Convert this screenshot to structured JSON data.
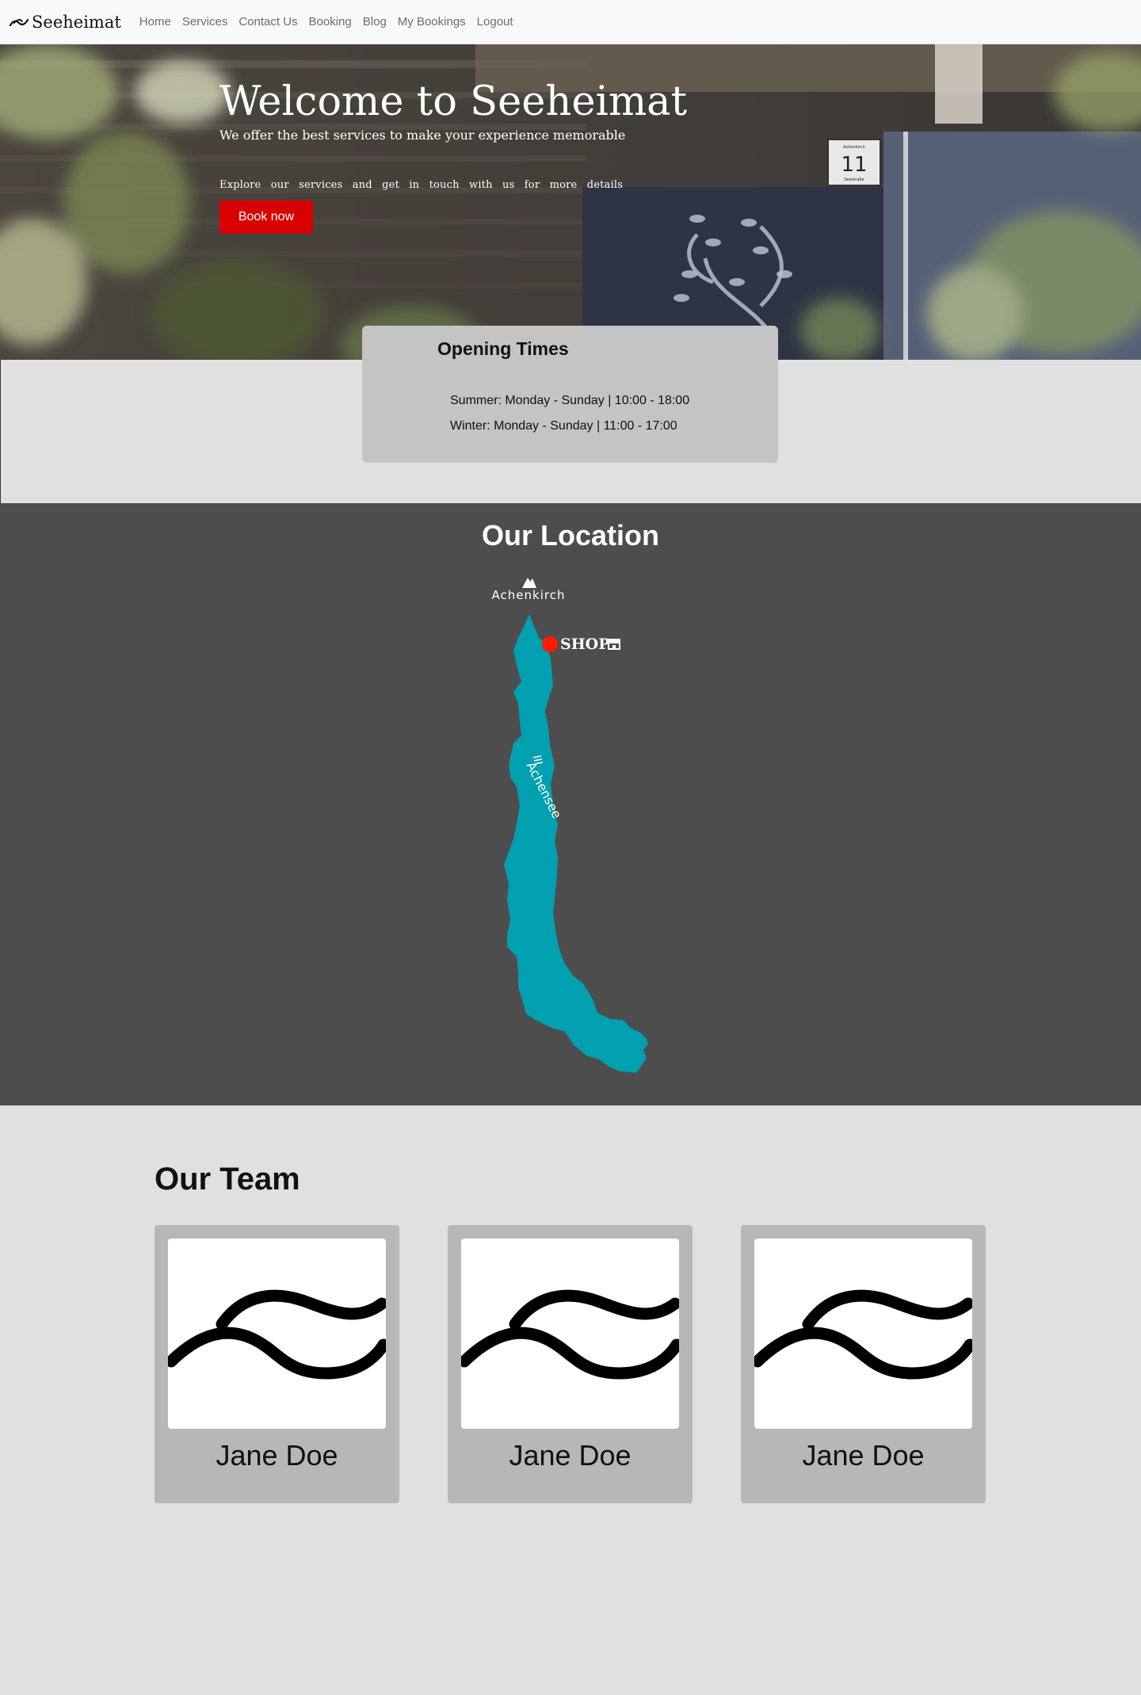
{
  "nav": {
    "brand": "Seeheimat",
    "brand_icon": "wave-logo-icon",
    "links": [
      "Home",
      "Services",
      "Contact Us",
      "Booking",
      "Blog",
      "My Bookings",
      "Logout"
    ]
  },
  "hero": {
    "title": "Welcome to Seeheimat",
    "subtitle": "We offer the best services to make your experience memorable",
    "text": "Explore our services and get in touch with us for more details",
    "button": "Book now",
    "house_number": "11",
    "street_sign": "Seestraße",
    "street_sign_top": "Achenkirch"
  },
  "opening": {
    "title": "Opening Times",
    "summer": "Summer: Monday - Sunday | 10:00 - 18:00",
    "winter": "Winter: Monday - Sunday | 11:00 - 17:00"
  },
  "location": {
    "title": "Our Location",
    "town": "Achenkirch",
    "town_icon": "mountain-icon",
    "lake": "Achensee",
    "lake_icon": "water-waves-icon",
    "shop_label": "SHOP",
    "shop_icon": "store-icon",
    "colors": {
      "lake": "#00a0b0",
      "marker": "#ff1a00",
      "background": "#4d4d4d"
    }
  },
  "team": {
    "title": "Our Team",
    "members": [
      {
        "name": "Jane Doe",
        "photo_icon": "wave-logo-icon"
      },
      {
        "name": "Jane Doe",
        "photo_icon": "wave-logo-icon"
      },
      {
        "name": "Jane Doe",
        "photo_icon": "wave-logo-icon"
      }
    ]
  },
  "colors": {
    "accent": "#d90000",
    "page_bg": "#e0e0e0",
    "card_bg": "#c4c4c4"
  }
}
